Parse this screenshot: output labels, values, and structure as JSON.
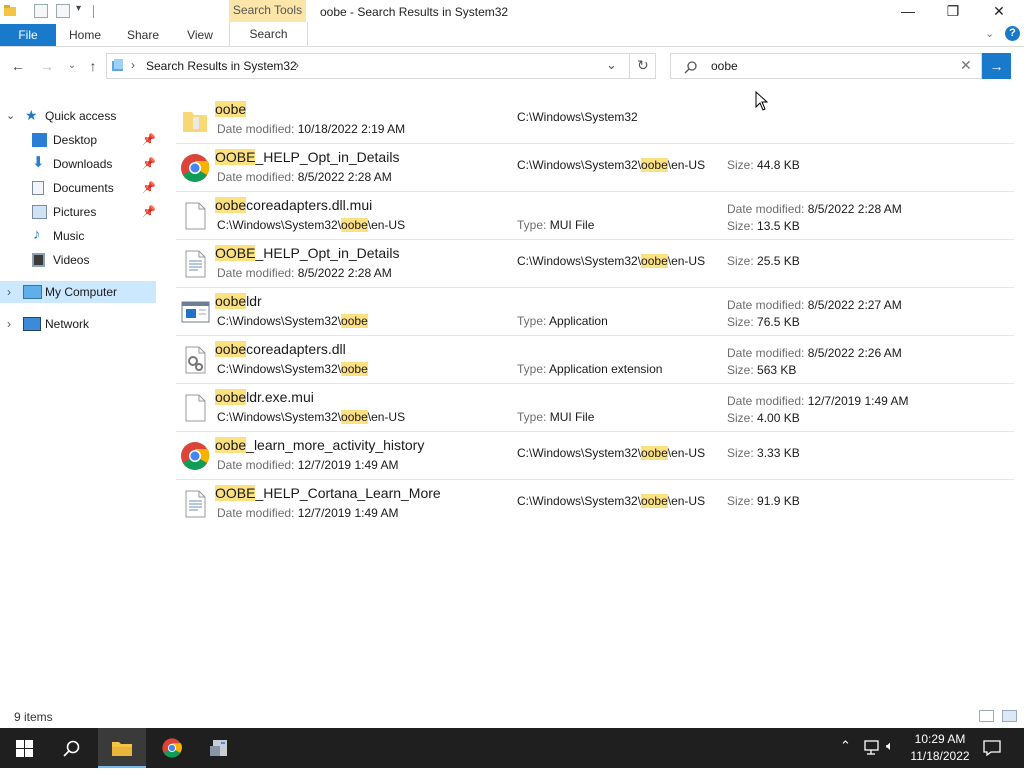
{
  "window": {
    "title": "oobe - Search Results in System32",
    "contextual_tab": "Search Tools",
    "controls": {
      "minimize": "—",
      "maximize": "❐",
      "close": "✕"
    }
  },
  "ribbon": {
    "tabs": [
      "File",
      "Home",
      "Share",
      "View",
      "Search"
    ],
    "active_tab": "Search"
  },
  "address": {
    "path_segment": "Search Results in System32",
    "search_value": "oobe"
  },
  "nav": {
    "quick_access": "Quick access",
    "items": [
      {
        "label": "Desktop",
        "pinned": true
      },
      {
        "label": "Downloads",
        "pinned": true
      },
      {
        "label": "Documents",
        "pinned": true
      },
      {
        "label": "Pictures",
        "pinned": true
      },
      {
        "label": "Music",
        "pinned": false
      },
      {
        "label": "Videos",
        "pinned": false
      }
    ],
    "my_computer": "My Computer",
    "network": "Network"
  },
  "results": [
    {
      "hl": "oobe",
      "rest": "",
      "icon": "folder-icon",
      "sub_key": "Date modified:",
      "sub_val": "10/18/2022 2:19 AM",
      "location": [
        "C:\\Windows\\System32"
      ],
      "size": ""
    },
    {
      "hl": "OOBE",
      "rest": "_HELP_Opt_in_Details",
      "icon": "chrome-icon",
      "sub_key": "Date modified:",
      "sub_val": "8/5/2022 2:28 AM",
      "location": [
        "C:\\Windows\\System32\\",
        "oobe",
        "\\en-US"
      ],
      "size": "44.8 KB"
    },
    {
      "hl": "oobe",
      "rest": "coreadapters.dll.mui",
      "icon": "file-icon",
      "sub_path": [
        "C:\\Windows\\System32\\",
        "oobe",
        "\\en-US"
      ],
      "type": "MUI File",
      "date": "8/5/2022 2:28 AM",
      "size": "13.5 KB"
    },
    {
      "hl": "OOBE",
      "rest": "_HELP_Opt_in_Details",
      "icon": "text-file-icon",
      "sub_key": "Date modified:",
      "sub_val": "8/5/2022 2:28 AM",
      "location": [
        "C:\\Windows\\System32\\",
        "oobe",
        "\\en-US"
      ],
      "size": "25.5 KB"
    },
    {
      "hl": "oobe",
      "rest": "ldr",
      "icon": "application-icon",
      "sub_path": [
        "C:\\Windows\\System32\\",
        "oobe",
        ""
      ],
      "type": "Application",
      "date": "8/5/2022 2:27 AM",
      "size": "76.5 KB"
    },
    {
      "hl": "oobe",
      "rest": "coreadapters.dll",
      "icon": "dll-icon",
      "sub_path": [
        "C:\\Windows\\System32\\",
        "oobe",
        ""
      ],
      "type": "Application extension",
      "date": "8/5/2022 2:26 AM",
      "size": "563 KB"
    },
    {
      "hl": "oobe",
      "rest": "ldr.exe.mui",
      "icon": "file-icon",
      "sub_path": [
        "C:\\Windows\\System32\\",
        "oobe",
        "\\en-US"
      ],
      "type": "MUI File",
      "date": "12/7/2019 1:49 AM",
      "size": "4.00 KB"
    },
    {
      "hl": "oobe",
      "rest": "_learn_more_activity_history",
      "icon": "chrome-icon",
      "sub_key": "Date modified:",
      "sub_val": "12/7/2019 1:49 AM",
      "location": [
        "C:\\Windows\\System32\\",
        "oobe",
        "\\en-US"
      ],
      "size": "3.33 KB"
    },
    {
      "hl": "OOBE",
      "rest": "_HELP_Cortana_Learn_More",
      "icon": "text-file-icon",
      "sub_key": "Date modified:",
      "sub_val": "12/7/2019 1:49 AM",
      "location": [
        "C:\\Windows\\System32\\",
        "oobe",
        "\\en-US"
      ],
      "size": "91.9 KB"
    }
  ],
  "labels": {
    "date_modified": "Date modified:",
    "size": "Size:",
    "type": "Type:"
  },
  "status": {
    "items": "9 items"
  },
  "taskbar": {
    "time": "10:29 AM",
    "date": "11/18/2022"
  },
  "colors": {
    "accent": "#1979ca",
    "highlight": "#fce183",
    "contextual_tab": "#fbe5a9",
    "selected_nav": "#cce8ff"
  }
}
